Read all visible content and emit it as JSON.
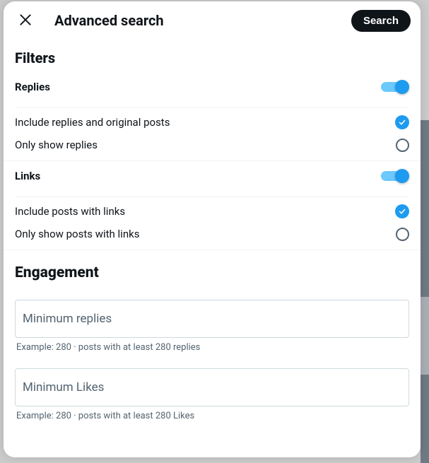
{
  "header": {
    "title": "Advanced search",
    "search_btn": "Search"
  },
  "filters": {
    "heading": "Filters",
    "replies": {
      "label": "Replies",
      "opt_include": "Include replies and original posts",
      "opt_only": "Only show replies"
    },
    "links": {
      "label": "Links",
      "opt_include": "Include posts with links",
      "opt_only": "Only show posts with links"
    }
  },
  "engagement": {
    "heading": "Engagement",
    "min_replies": {
      "placeholder": "Minimum replies",
      "hint": "Example: 280 · posts with at least 280 replies"
    },
    "min_likes": {
      "placeholder": "Minimum Likes",
      "hint": "Example: 280 · posts with at least 280 Likes"
    }
  }
}
